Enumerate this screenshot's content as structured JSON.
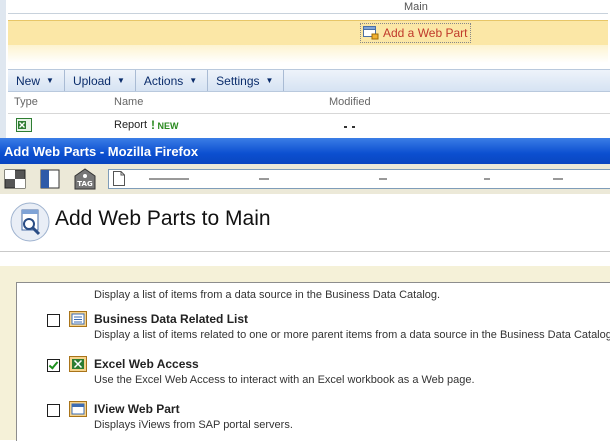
{
  "background_page": {
    "zone_label": "Main",
    "add_web_part_label": "Add a Web Part",
    "toolbar": [
      {
        "label": "New"
      },
      {
        "label": "Upload"
      },
      {
        "label": "Actions"
      },
      {
        "label": "Settings"
      }
    ],
    "columns": [
      "Type",
      "Name",
      "Modified"
    ],
    "row": {
      "name": "Report",
      "badge": "NEW",
      "badge_mark": "!"
    }
  },
  "firefox": {
    "title": "Add Web Parts - Mozilla Firefox",
    "toolbar_icons": [
      "back-forward-icon",
      "bookmark-sidebar-icon",
      "tag-icon"
    ],
    "tag_label": "TAG"
  },
  "dialog": {
    "title": "Add Web Parts to Main",
    "top_description": "Display a list of items from a data source in the Business Data Catalog.",
    "items": [
      {
        "title": "Business Data Related List",
        "description": "Display a list of items related to one or more parent items from a data source in the Business Data Catalog.",
        "checked": false,
        "icon": "list-icon"
      },
      {
        "title": "Excel Web Access",
        "description": "Use the Excel Web Access to interact with an Excel workbook as a Web page.",
        "checked": true,
        "icon": "excel-icon"
      },
      {
        "title": "IView Web Part",
        "description": "Displays iViews from SAP portal servers.",
        "checked": false,
        "icon": "window-icon"
      }
    ]
  },
  "colors": {
    "title_bar": "#0b4fd0",
    "add_band": "#fbe7a6",
    "toolbar_text": "#0a2c6b",
    "dialog_body": "#f5f1d8",
    "add_link_text": "#c0392b"
  }
}
